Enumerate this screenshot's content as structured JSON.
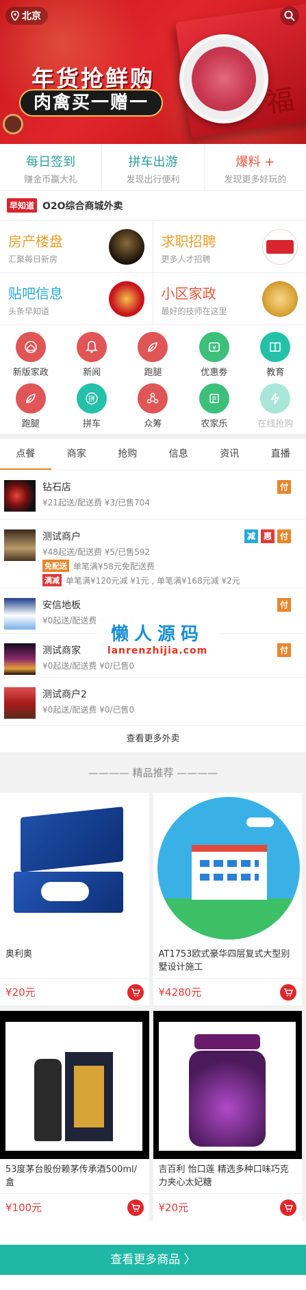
{
  "header": {
    "city": "北京",
    "promo_title": "年货抢鲜购",
    "promo_sub": "肉禽买一赠一",
    "fu_char": "福"
  },
  "quick": [
    {
      "title": "每日签到",
      "sub": "赚金币赢大礼",
      "color": "#2aa198"
    },
    {
      "title": "拼车出游",
      "sub": "发现出行便利",
      "color": "#2aa198"
    },
    {
      "title": "爆料 +",
      "sub": "发现更多好玩的",
      "color": "#e8553a"
    }
  ],
  "news": {
    "badge": "早知道",
    "text": "O2O综合商城外卖"
  },
  "info": [
    {
      "title": "房产楼盘",
      "sub": "汇聚每日新房",
      "color": "#e8a02b"
    },
    {
      "title": "求职招聘",
      "sub": "更多人才招聘",
      "color": "#e8a02b"
    },
    {
      "title": "贴吧信息",
      "sub": "头条早知道",
      "color": "#2aa8d9"
    },
    {
      "title": "小区家政",
      "sub": "最好的技师在这里",
      "color": "#e8553a"
    }
  ],
  "icons": [
    {
      "label": "新版家政",
      "icon": "home-icon",
      "color": "#e05555"
    },
    {
      "label": "新闻",
      "icon": "bell-icon",
      "color": "#e05555"
    },
    {
      "label": "跑腿",
      "icon": "leaf-icon",
      "color": "#e05555"
    },
    {
      "label": "优惠劵",
      "icon": "coupon-icon",
      "color": "#3cbf7a"
    },
    {
      "label": "教育",
      "icon": "book-icon",
      "color": "#25c0a8"
    },
    {
      "label": "跑腿",
      "icon": "leaf-icon",
      "color": "#e05555"
    },
    {
      "label": "拼车",
      "icon": "carpool-icon",
      "color": "#25c0a8"
    },
    {
      "label": "众筹",
      "icon": "crowdfund-icon",
      "color": "#e05555"
    },
    {
      "label": "农家乐",
      "icon": "farm-icon",
      "color": "#3cbf7a"
    },
    {
      "label": "在线抢购",
      "icon": "flash-icon",
      "color": "#a9e6d8"
    }
  ],
  "tabs": [
    "点餐",
    "商家",
    "抢购",
    "信息",
    "资讯",
    "直播"
  ],
  "shops": [
    {
      "name": "钻石店",
      "meta": "¥21起送/配送费 ¥3/已售704",
      "badges": [
        "付"
      ]
    },
    {
      "name": "测试商户",
      "meta": "¥48起送/配送费 ¥5/已售592",
      "badges": [
        "减",
        "惠",
        "付"
      ],
      "promos": [
        {
          "tag": "免配送",
          "text": "单笔满¥58元免配送费",
          "color": "#e8862b"
        },
        {
          "tag": "满减",
          "text": "单笔满¥120元减 ¥1元 , 单笔满¥168元减 ¥2元",
          "color": "#e03a3a"
        }
      ]
    },
    {
      "name": "安信地板",
      "meta": "¥0起送/配送费 ¥0/已售0",
      "badges": [
        "付"
      ]
    },
    {
      "name": "测试商家",
      "meta": "¥0起送/配送费 ¥0/已售0",
      "badges": [
        "付"
      ]
    },
    {
      "name": "测试商户2",
      "meta": "¥0起送/配送费 ¥0/已售0",
      "badges": []
    }
  ],
  "more_takeout": "查看更多外卖",
  "watermark": {
    "cn": "懒人源码",
    "en": "lanrenzhijia.com"
  },
  "goods_head": "———— 精品推荐 ————",
  "goods": [
    {
      "name": "奥利奥",
      "price": "¥20元"
    },
    {
      "name": "AT1753欧式豪华四层复式大型别墅设计施工",
      "price": "¥4280元"
    },
    {
      "name": "53度茅台股份赖茅传承酒500ml/盒",
      "price": "¥100元"
    },
    {
      "name": "吉百利 怡口莲 精选多种口味巧克力夹心太妃糖",
      "price": "¥20元"
    }
  ],
  "more_goods": "查看更多商品 〉",
  "colors": {
    "brand_red": "#e0262b",
    "teal": "#1fb8a6",
    "badge_fu": "#e8862b",
    "badge_jian": "#2aa8d9",
    "badge_hui": "#e03a3a"
  }
}
